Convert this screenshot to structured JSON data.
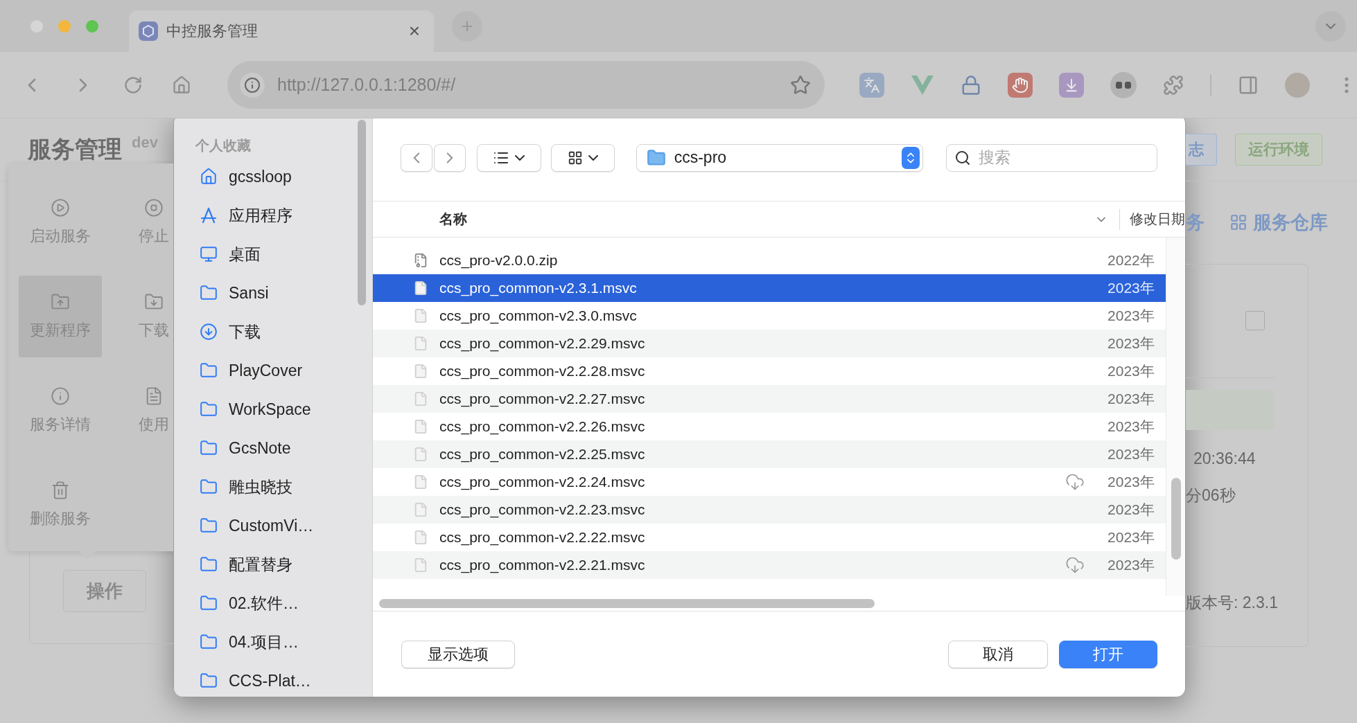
{
  "browser": {
    "tab": {
      "title": "中控服务管理",
      "close": "×"
    },
    "new_tab": "+",
    "address": "http://127.0.0.1:1280/#/"
  },
  "page": {
    "title": "服务管理",
    "badge": "dev",
    "actions": [
      {
        "label": "启动服务",
        "kind": "play",
        "selected": false
      },
      {
        "label": "停止",
        "kind": "stop",
        "selected": false
      },
      {
        "label": "更新程序",
        "kind": "upload",
        "selected": true
      },
      {
        "label": "下载",
        "kind": "download",
        "selected": false
      },
      {
        "label": "服务详情",
        "kind": "info",
        "selected": false
      },
      {
        "label": "使用",
        "kind": "doc",
        "selected": false
      },
      {
        "label": "删除服务",
        "kind": "trash",
        "selected": false
      }
    ],
    "operate_button": "操作",
    "header_buttons": [
      {
        "label": "志",
        "kind": "info"
      },
      {
        "label": "运行环境",
        "kind": "success"
      }
    ],
    "nav": [
      {
        "label": "务",
        "kind": "plain"
      },
      {
        "label": "服务仓库",
        "kind": "grid"
      }
    ],
    "card": {
      "checked": false,
      "time": "20:36:44",
      "duration": "分06秒",
      "version": "版本号: 2.3.1"
    }
  },
  "dialog": {
    "sidebar": {
      "heading": "个人收藏",
      "items": [
        {
          "label": "gcssloop",
          "kind": "home"
        },
        {
          "label": "应用程序",
          "kind": "apps"
        },
        {
          "label": "桌面",
          "kind": "desktop"
        },
        {
          "label": "Sansi",
          "kind": "folder"
        },
        {
          "label": "下载",
          "kind": "download"
        },
        {
          "label": "PlayCover",
          "kind": "folder"
        },
        {
          "label": "WorkSpace",
          "kind": "folder"
        },
        {
          "label": "GcsNote",
          "kind": "folder"
        },
        {
          "label": "雕虫晓技",
          "kind": "folder"
        },
        {
          "label": "CustomVi…",
          "kind": "folder"
        },
        {
          "label": "配置替身",
          "kind": "folder"
        },
        {
          "label": "02.软件…",
          "kind": "folder"
        },
        {
          "label": "04.项目…",
          "kind": "folder"
        },
        {
          "label": "CCS-Plat…",
          "kind": "folder"
        }
      ]
    },
    "location": "ccs-pro",
    "search": {
      "placeholder": "搜索"
    },
    "columns": [
      "名称",
      "修改日期"
    ],
    "files": [
      {
        "name": "ccs_pro-v2.0.0.zip",
        "date": "2022年",
        "kind": "zip",
        "selected": false,
        "cloud": false
      },
      {
        "name": "ccs_pro_common-v2.3.1.msvc",
        "date": "2023年",
        "kind": "file",
        "selected": true,
        "cloud": false
      },
      {
        "name": "ccs_pro_common-v2.3.0.msvc",
        "date": "2023年",
        "kind": "file",
        "selected": false,
        "cloud": false
      },
      {
        "name": "ccs_pro_common-v2.2.29.msvc",
        "date": "2023年",
        "kind": "file",
        "selected": false,
        "cloud": false
      },
      {
        "name": "ccs_pro_common-v2.2.28.msvc",
        "date": "2023年",
        "kind": "file",
        "selected": false,
        "cloud": false
      },
      {
        "name": "ccs_pro_common-v2.2.27.msvc",
        "date": "2023年",
        "kind": "file",
        "selected": false,
        "cloud": false
      },
      {
        "name": "ccs_pro_common-v2.2.26.msvc",
        "date": "2023年",
        "kind": "file",
        "selected": false,
        "cloud": false
      },
      {
        "name": "ccs_pro_common-v2.2.25.msvc",
        "date": "2023年",
        "kind": "file",
        "selected": false,
        "cloud": false
      },
      {
        "name": "ccs_pro_common-v2.2.24.msvc",
        "date": "2023年",
        "kind": "file",
        "selected": false,
        "cloud": true
      },
      {
        "name": "ccs_pro_common-v2.2.23.msvc",
        "date": "2023年",
        "kind": "file",
        "selected": false,
        "cloud": false
      },
      {
        "name": "ccs_pro_common-v2.2.22.msvc",
        "date": "2023年",
        "kind": "file",
        "selected": false,
        "cloud": false
      },
      {
        "name": "ccs_pro_common-v2.2.21.msvc",
        "date": "2023年",
        "kind": "file",
        "selected": false,
        "cloud": true
      }
    ],
    "buttons": {
      "options": "显示选项",
      "cancel": "取消",
      "open": "打开"
    }
  }
}
